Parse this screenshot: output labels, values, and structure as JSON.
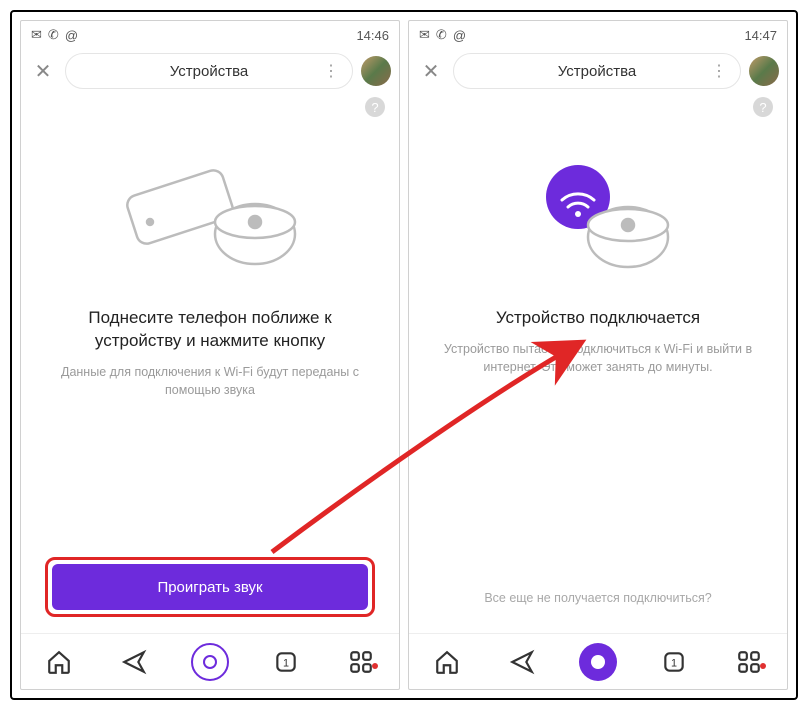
{
  "left": {
    "status_time": "14:46",
    "nav_title": "Устройства",
    "heading": "Поднесите телефон поближе к устройству и нажмите кнопку",
    "subtext": "Данные для подключения к Wi-Fi будут переданы с помощью звука",
    "button_label": "Проиграть звук"
  },
  "right": {
    "status_time": "14:47",
    "nav_title": "Устройства",
    "heading": "Устройство подключается",
    "subtext": "Устройство пытается подключиться к Wi-Fi и выйти в интернет. Это может занять до минуты.",
    "footer_link": "Все еще не получается подключиться?"
  },
  "icons": {
    "help": "?",
    "close": "✕",
    "dots": "⋮",
    "mail": "✉",
    "whatsapp": "✆",
    "at": "@"
  }
}
